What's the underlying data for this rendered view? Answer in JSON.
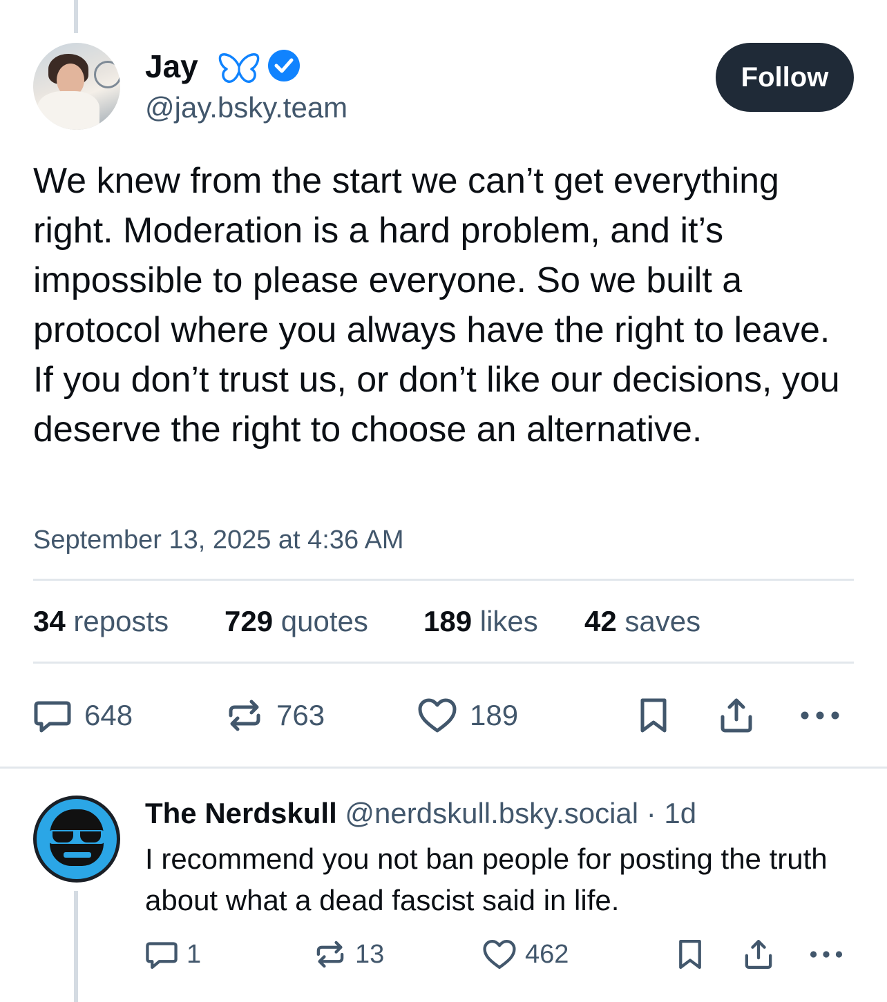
{
  "post": {
    "author": {
      "name": "Jay",
      "handle": "@jay.bsky.team"
    },
    "follow_label": "Follow",
    "text": "We knew from the start we can’t get everything right. Moderation is a hard problem, and it’s impossible to please everyone. So we built a protocol where you always have the right to leave. If you don’t trust us, or don’t like our decisions, you deserve the right to choose an alternative.",
    "timestamp": "September 13, 2025 at 4:36 AM",
    "stats": [
      {
        "count": "34",
        "label": "reposts"
      },
      {
        "count": "729",
        "label": "quotes"
      },
      {
        "count": "189",
        "label": "likes"
      },
      {
        "count": "42",
        "label": "saves"
      }
    ],
    "actions": {
      "reply_count": "648",
      "repost_count": "763",
      "like_count": "189"
    }
  },
  "reply": {
    "author_name": "The Nerdskull",
    "meta": "@nerdskull.bsky.social · 1d",
    "text": "I recommend you not ban people for posting the truth about what a dead fascist said in life.",
    "actions": {
      "reply_count": "1",
      "repost_count": "13",
      "like_count": "462"
    }
  },
  "colors": {
    "text_primary": "#0b0f14",
    "text_secondary": "#42576c",
    "follow_button_bg": "#1f2a37",
    "verified_blue": "#1083fe",
    "butterfly_blue": "#1083fe",
    "divider": "#e2e7ec"
  },
  "icons": [
    "butterfly-icon",
    "verified-badge-icon",
    "reply-icon",
    "repost-icon",
    "like-icon",
    "bookmark-icon",
    "share-icon",
    "more-icon"
  ]
}
